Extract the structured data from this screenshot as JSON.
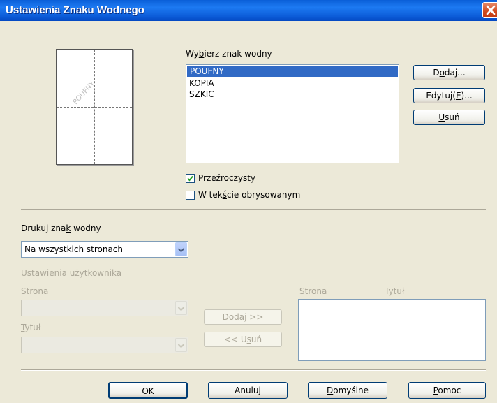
{
  "window": {
    "title": "Ustawienia Znaku Wodnego",
    "close_icon": "close-icon"
  },
  "preview": {
    "watermark_text": "POUFNY"
  },
  "watermark_select": {
    "label_pre": "Wy",
    "label_u": "b",
    "label_post": "ierz znak wodny",
    "items": [
      "POUFNY",
      "KOPIA",
      "SZKIC"
    ],
    "selected_index": 0
  },
  "buttons_right": {
    "add_pre": "D",
    "add_u": "o",
    "add_post": "daj...",
    "edit_pre": "Edytuj(",
    "edit_u": "E",
    "edit_post": ")...",
    "remove_u": "U",
    "remove_post": "suń"
  },
  "checkboxes": {
    "transparent_pre": "Pr",
    "transparent_u": "z",
    "transparent_post": "eźroczysty",
    "transparent_checked": true,
    "outline_pre": "W tek",
    "outline_u": "ś",
    "outline_post": "cie obrysowanym",
    "outline_checked": false
  },
  "print": {
    "label_pre": "Drukuj zna",
    "label_u": "k",
    "label_post": " wodny",
    "selected": "Na wszystkich stronach"
  },
  "user_settings": {
    "title": "Ustawienia użytkownika",
    "page_pre": "St",
    "page_u": "r",
    "page_post": "ona",
    "title_field_u": "T",
    "title_field_post": "ytuł",
    "add_label": "Dodaj >>",
    "remove_pre": "<< U",
    "remove_u": "s",
    "remove_post": "uń",
    "col_page_pre": "Stro",
    "col_page_u": "n",
    "col_page_post": "a",
    "col_title": "Tytuł"
  },
  "footer": {
    "ok": "OK",
    "cancel": "Anuluj",
    "default_u": "D",
    "default_post": "omyślne",
    "help_u": "P",
    "help_post": "omoc"
  },
  "colors": {
    "accent": "#316AC5",
    "titlebar": "#0A5FD8",
    "check": "#21A121"
  }
}
